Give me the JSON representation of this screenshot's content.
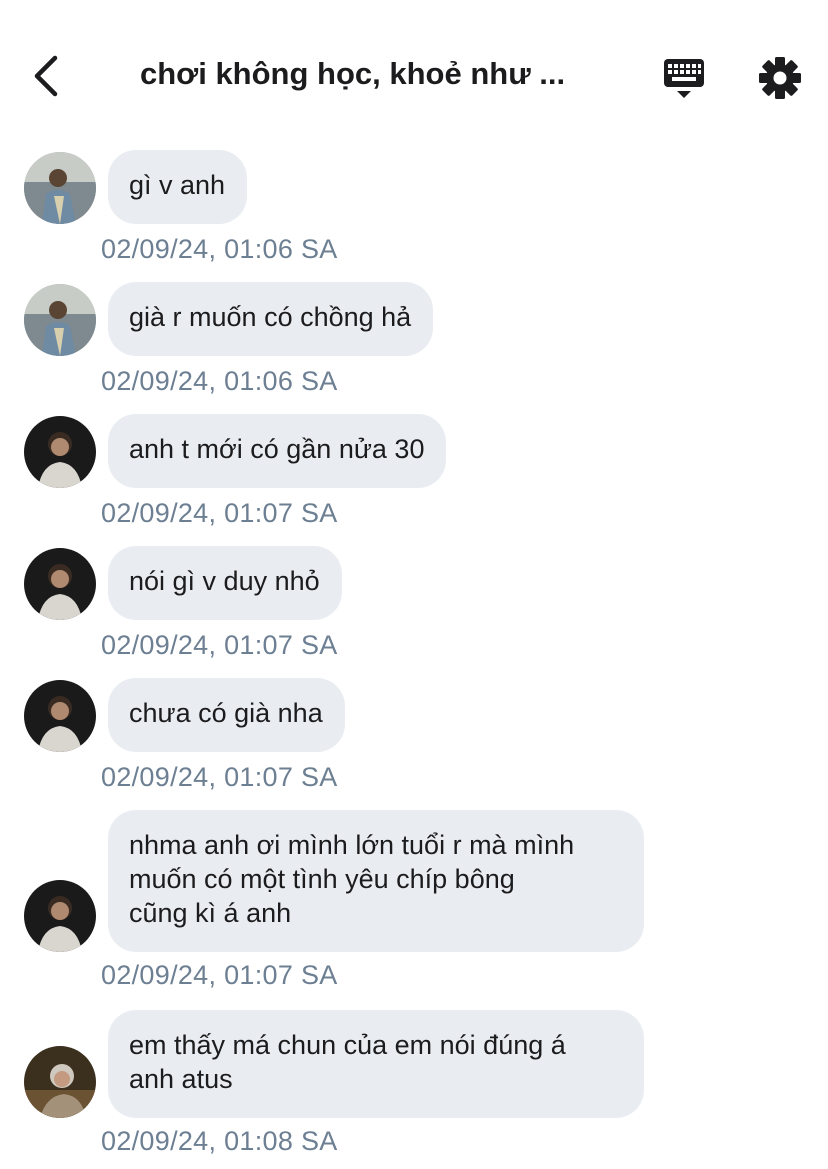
{
  "header": {
    "title": "chơi không học, khoẻ như ..."
  },
  "icons": {
    "back": "chevron-left-icon",
    "keyboard": "keyboard-icon",
    "settings": "gear-icon"
  },
  "colors": {
    "bubble": "#e9edf1",
    "timestamp": "#6d7f92",
    "text": "#1c1c1e"
  },
  "messages": [
    {
      "text": "gì v anh",
      "time": "02/09/24, 01:06 SA",
      "avatar": "user-a"
    },
    {
      "text": "già r muốn có chồng hả",
      "time": "02/09/24, 01:06 SA",
      "avatar": "user-a"
    },
    {
      "text": "anh t mới có gần nửa 30",
      "time": "02/09/24, 01:07 SA",
      "avatar": "user-b"
    },
    {
      "text": "nói gì v duy nhỏ",
      "time": "02/09/24, 01:07 SA",
      "avatar": "user-b"
    },
    {
      "text": "chưa có già nha",
      "time": "02/09/24, 01:07 SA",
      "avatar": "user-b"
    },
    {
      "lines": [
        "nhma anh ơi mình lớn tuổi r mà mình",
        "muốn có một tình yêu chíp bông",
        "cũng kì á anh"
      ],
      "time": "02/09/24, 01:07 SA",
      "avatar": "user-b"
    },
    {
      "lines": [
        "em thấy má chun của em nói đúng á",
        "anh atus"
      ],
      "time": "02/09/24, 01:08 SA",
      "avatar": "user-c"
    }
  ]
}
